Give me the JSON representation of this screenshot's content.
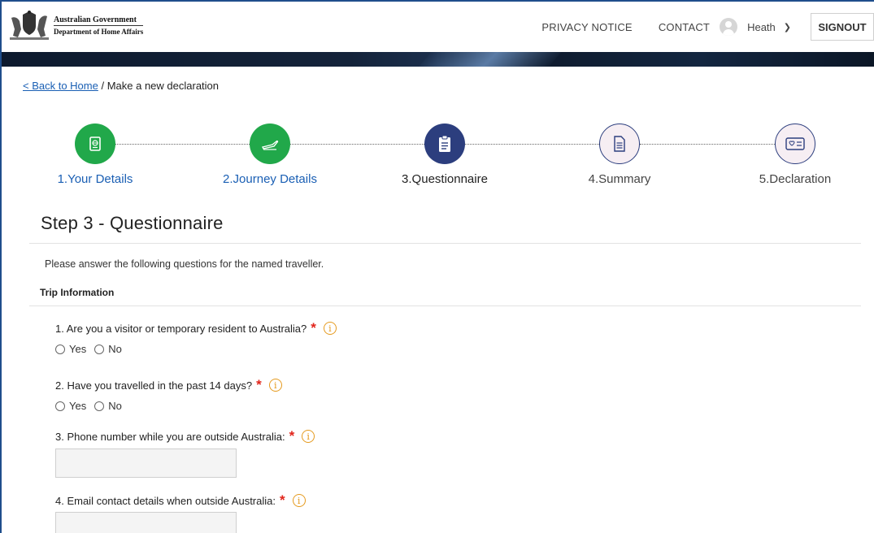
{
  "header": {
    "gov_line1": "Australian Government",
    "gov_line2": "Department of Home Affairs",
    "privacy_label": "PRIVACY NOTICE",
    "contact_label": "CONTACT",
    "user_name": "Heath",
    "signout_label": "SIGNOUT"
  },
  "breadcrumb": {
    "back_link": "< Back to Home",
    "separator": " / ",
    "current": "Make a new declaration"
  },
  "stepper": {
    "steps": [
      {
        "label": "1.Your Details",
        "state": "done",
        "icon": "passport-icon"
      },
      {
        "label": "2.Journey Details",
        "state": "done",
        "icon": "plane-icon"
      },
      {
        "label": "3.Questionnaire",
        "state": "current",
        "icon": "clipboard-icon"
      },
      {
        "label": "4.Summary",
        "state": "todo",
        "icon": "document-icon"
      },
      {
        "label": "5.Declaration",
        "state": "todo",
        "icon": "card-icon"
      }
    ]
  },
  "page": {
    "title": "Step 3 - Questionnaire",
    "intro": "Please answer the following questions for the named traveller.",
    "section_title": "Trip Information"
  },
  "questions": [
    {
      "text": "1. Are you a visitor or temporary resident to Australia?",
      "type": "radio",
      "options": [
        "Yes",
        "No"
      ]
    },
    {
      "text": "2. Have you travelled in the past 14 days?",
      "type": "radio",
      "options": [
        "Yes",
        "No"
      ]
    },
    {
      "text": "3. Phone number while you are outside Australia:",
      "type": "text",
      "value": ""
    },
    {
      "text": "4. Email contact details when outside Australia:",
      "type": "text",
      "value": ""
    }
  ],
  "required_marker": "*",
  "info_icon_glyph": "i",
  "colors": {
    "done": "#21a84a",
    "current": "#2c3e7e",
    "link": "#1a5fb4",
    "required": "#e1251b",
    "info": "#e59a1e"
  }
}
